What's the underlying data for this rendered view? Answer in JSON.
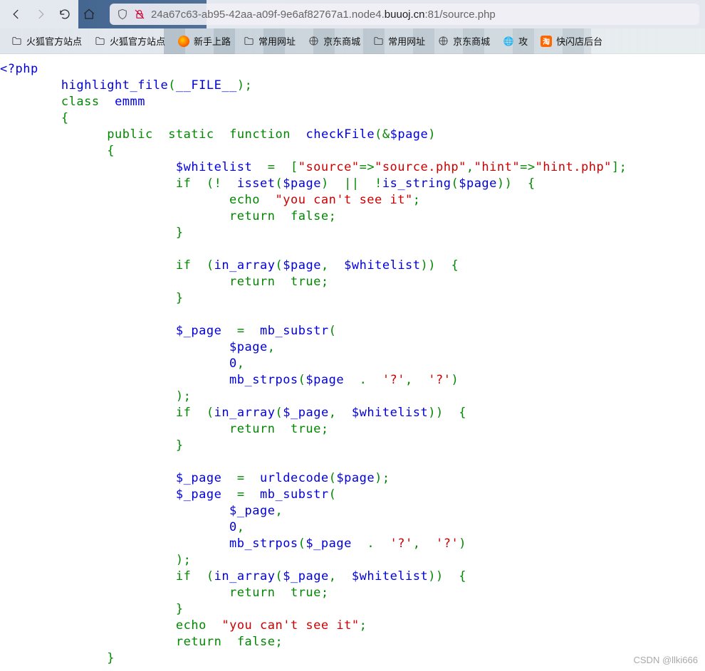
{
  "nav": {
    "url_prefix": "24a67c63-ab95-42aa-a09f-9e6af82767a1.node4.",
    "url_bold": "buuoj.cn",
    "url_suffix": ":81/source.php"
  },
  "bookmarks": [
    {
      "label": "火狐官方站点",
      "icon": "folder"
    },
    {
      "label": "火狐官方站点",
      "icon": "folder"
    },
    {
      "label": "新手上路",
      "icon": "firefox"
    },
    {
      "label": "常用网址",
      "icon": "folder"
    },
    {
      "label": "京东商城",
      "icon": "globe"
    },
    {
      "label": "常用网址",
      "icon": "folder"
    },
    {
      "label": "京东商城",
      "icon": "globe"
    },
    {
      "label": "攻",
      "icon": "g"
    },
    {
      "label": "快闪店后台",
      "icon": "tao"
    }
  ],
  "code": {
    "open": "<?php",
    "hl": "highlight_file",
    "file": "__FILE__",
    "class": "class",
    "cname": "emmm",
    "public": "public",
    "static": "static",
    "function": "function",
    "fname": "checkFile",
    "param": "$page",
    "wl": "$whitelist",
    "src_k": "\"source\"",
    "src_v": "\"source.php\"",
    "hint_k": "\"hint\"",
    "hint_v": "\"hint.php\"",
    "if": "if",
    "isset": "isset",
    "is_string": "is_string",
    "echo": "echo",
    "msg": "\"you can't see it\"",
    "return": "return",
    "false": "false",
    "true": "true",
    "in_array": "in_array",
    "p2": "$_page",
    "mb_substr": "mb_substr",
    "mb_strpos": "mb_strpos",
    "q": "'?'",
    "zero": "0",
    "urldecode": "urldecode"
  },
  "watermark": "CSDN @llki666",
  "tao_char": "淘",
  "g_char": "🌐"
}
